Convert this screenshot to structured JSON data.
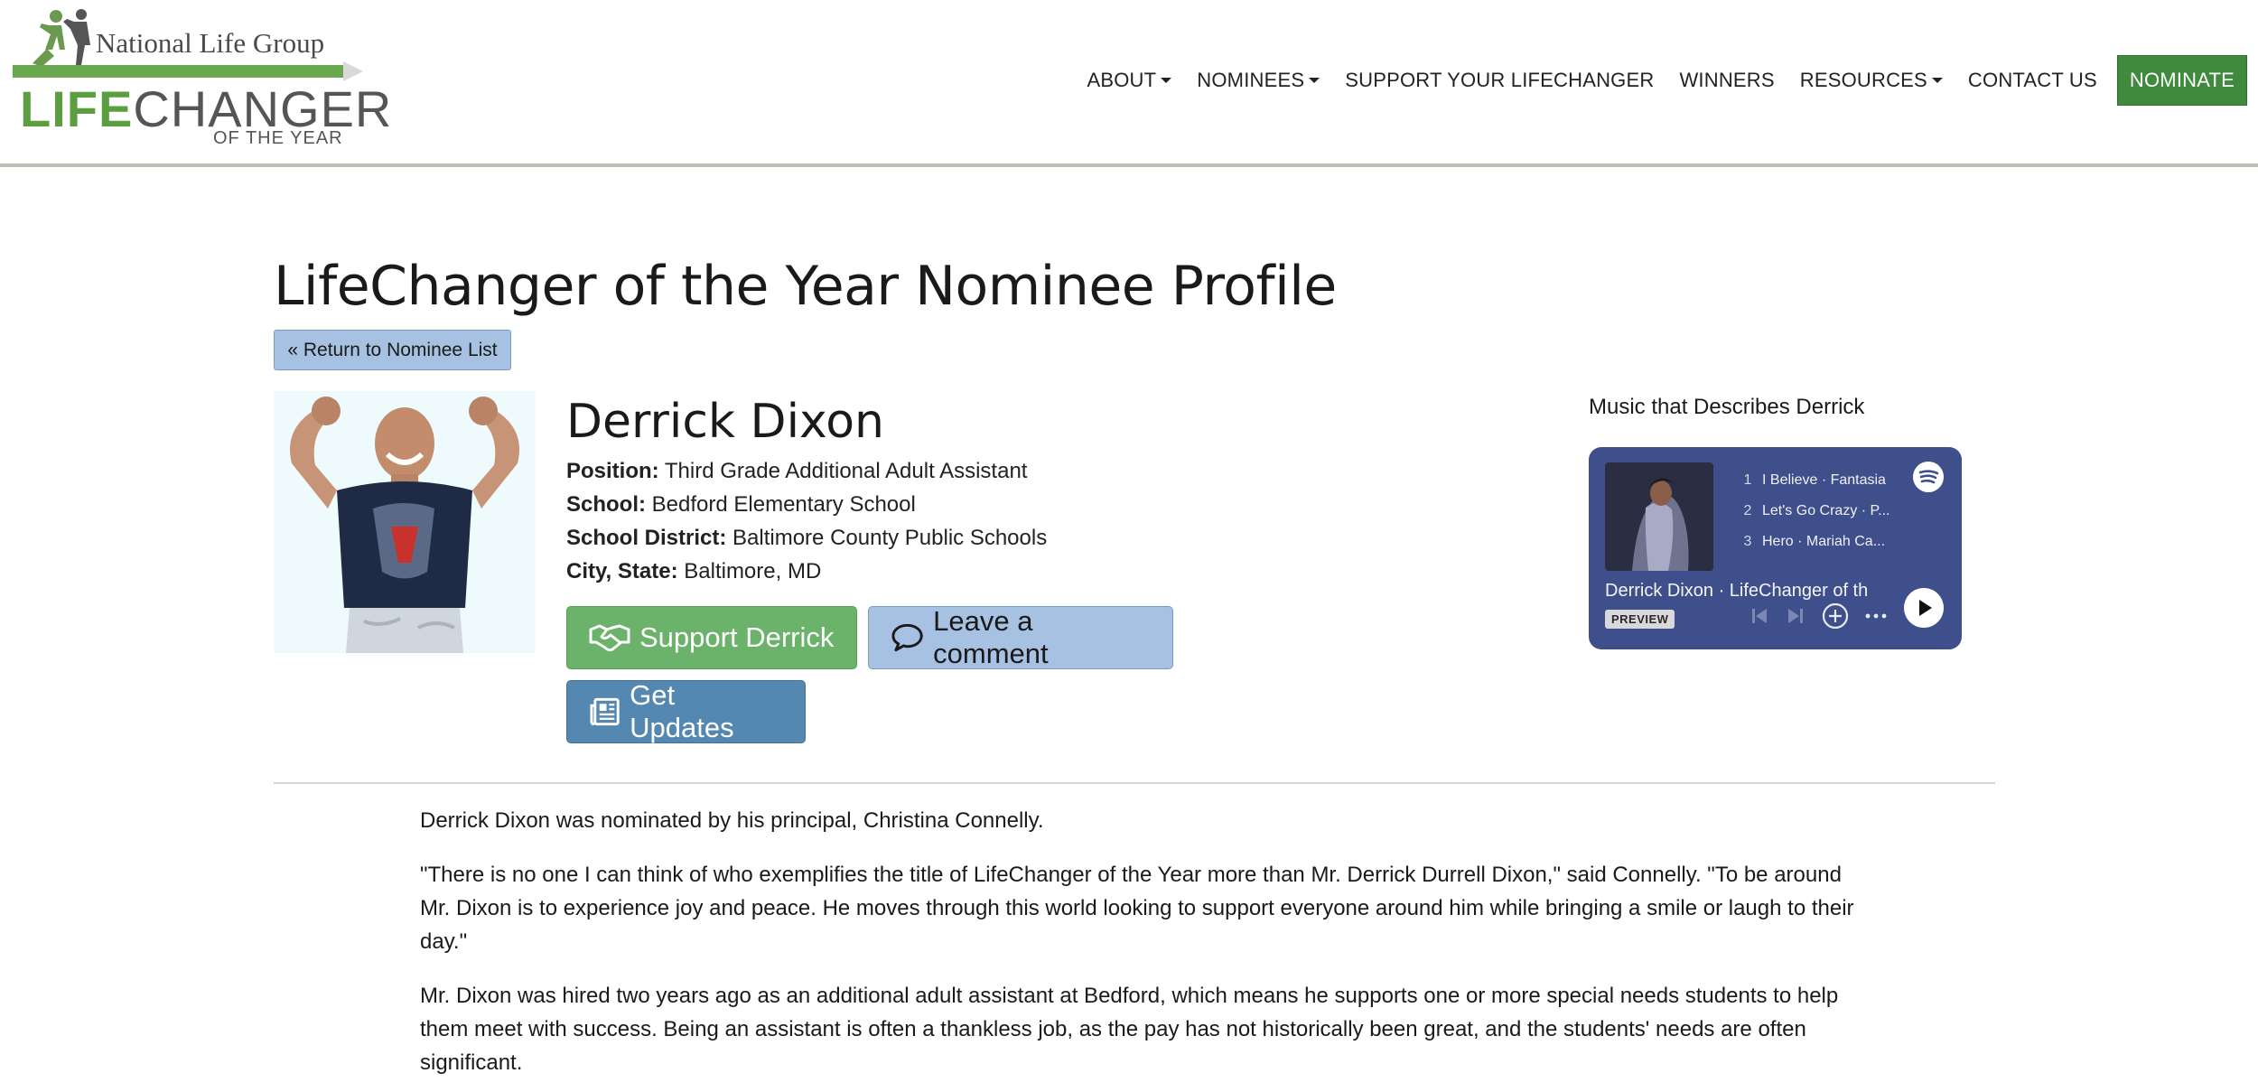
{
  "header": {
    "logo": {
      "brand": "National Life Group",
      "title_part1": "LIFE",
      "title_part2": "CHANGER",
      "subtitle": "OF THE YEAR"
    },
    "nav": [
      {
        "label": "ABOUT",
        "dropdown": true
      },
      {
        "label": "NOMINEES",
        "dropdown": true
      },
      {
        "label": "SUPPORT YOUR LIFECHANGER",
        "dropdown": false
      },
      {
        "label": "WINNERS",
        "dropdown": false
      },
      {
        "label": "RESOURCES",
        "dropdown": true
      },
      {
        "label": "CONTACT US",
        "dropdown": false
      }
    ],
    "cta": "NOMINATE"
  },
  "page": {
    "title": "LifeChanger of the Year Nominee Profile",
    "return_label": "« Return to Nominee List"
  },
  "nominee": {
    "name": "Derrick Dixon",
    "position_label": "Position:",
    "position": "Third Grade Additional Adult Assistant",
    "school_label": "School:",
    "school": "Bedford Elementary School",
    "district_label": "School District:",
    "district": "Baltimore County Public Schools",
    "city_label": "City, State:",
    "city": "Baltimore, MD"
  },
  "actions": {
    "support": "Support Derrick",
    "comment": "Leave a comment",
    "updates": "Get Updates"
  },
  "music": {
    "heading": "Music that Describes Derrick",
    "tracks": [
      {
        "num": "1",
        "text": "I Believe · Fantasia"
      },
      {
        "num": "2",
        "text": "Let's Go Crazy · P..."
      },
      {
        "num": "3",
        "text": "Hero · Mariah Ca..."
      }
    ],
    "playlist": "Derrick Dixon · LifeChanger of th",
    "preview": "PREVIEW"
  },
  "article": {
    "p1": "Derrick Dixon was nominated by his principal, Christina Connelly.",
    "p2": "\"There is no one I can think of who exemplifies the title of LifeChanger of the Year more than Mr. Derrick Durrell Dixon,\" said Connelly. \"To be around Mr. Dixon is to experience joy and peace. He moves through this world looking to support everyone around him while bringing a smile or laugh to their day.\"",
    "p3": "Mr. Dixon was hired two years ago as an additional adult assistant at Bedford, which means he supports one or more special needs students to help them meet with success. Being an assistant is often a thankless job, as the pay has not historically been great, and the students' needs are often significant."
  },
  "colors": {
    "brand_green": "#5b9e3f",
    "cta_green": "#3f8a3c",
    "support_green": "#6bb26b",
    "comment_blue": "#a7c1e2",
    "updates_blue": "#5488b1",
    "spotify_bg": "#3e4f8c"
  }
}
